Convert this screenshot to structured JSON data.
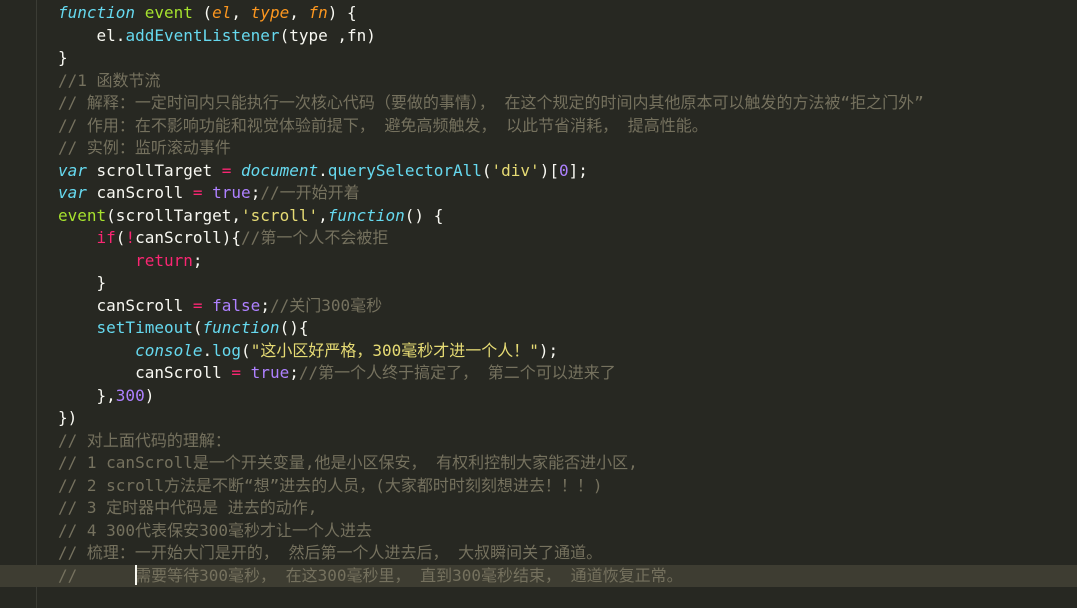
{
  "editor": {
    "lines": [
      {
        "segments": [
          {
            "t": "function",
            "c": "kw-it"
          },
          {
            "t": " ",
            "c": "plain"
          },
          {
            "t": "event",
            "c": "fn-name"
          },
          {
            "t": " (",
            "c": "plain"
          },
          {
            "t": "el",
            "c": "param"
          },
          {
            "t": ", ",
            "c": "plain"
          },
          {
            "t": "type",
            "c": "param"
          },
          {
            "t": ", ",
            "c": "plain"
          },
          {
            "t": "fn",
            "c": "param"
          },
          {
            "t": ") {",
            "c": "plain"
          }
        ]
      },
      {
        "segments": [
          {
            "t": "    el.",
            "c": "plain"
          },
          {
            "t": "addEventListener",
            "c": "method"
          },
          {
            "t": "(type ,fn)",
            "c": "plain"
          }
        ]
      },
      {
        "segments": [
          {
            "t": "}",
            "c": "plain"
          }
        ]
      },
      {
        "segments": [
          {
            "t": "//1 函数节流",
            "c": "com"
          }
        ]
      },
      {
        "segments": [
          {
            "t": "// 解释：一定时间内只能执行一次核心代码（要做的事情）， 在这个规定的时间内其他原本可以触发的方法被“拒之门外”",
            "c": "com"
          }
        ]
      },
      {
        "segments": [
          {
            "t": "// 作用：在不影响功能和视觉体验前提下， 避免高频触发， 以此节省消耗， 提高性能。",
            "c": "com"
          }
        ]
      },
      {
        "segments": [
          {
            "t": "// 实例：监听滚动事件",
            "c": "com"
          }
        ]
      },
      {
        "segments": [
          {
            "t": "var",
            "c": "kw-it"
          },
          {
            "t": " scrollTarget ",
            "c": "plain"
          },
          {
            "t": "=",
            "c": "op"
          },
          {
            "t": " ",
            "c": "plain"
          },
          {
            "t": "document",
            "c": "kw-it"
          },
          {
            "t": ".",
            "c": "plain"
          },
          {
            "t": "querySelectorAll",
            "c": "method"
          },
          {
            "t": "(",
            "c": "plain"
          },
          {
            "t": "'div'",
            "c": "str"
          },
          {
            "t": ")[",
            "c": "plain"
          },
          {
            "t": "0",
            "c": "num"
          },
          {
            "t": "];",
            "c": "plain"
          }
        ]
      },
      {
        "segments": [
          {
            "t": "var",
            "c": "kw-it"
          },
          {
            "t": " canScroll ",
            "c": "plain"
          },
          {
            "t": "=",
            "c": "op"
          },
          {
            "t": " ",
            "c": "plain"
          },
          {
            "t": "true",
            "c": "num"
          },
          {
            "t": ";",
            "c": "plain"
          },
          {
            "t": "//一开始开着",
            "c": "com"
          }
        ]
      },
      {
        "segments": [
          {
            "t": "event",
            "c": "fn-name"
          },
          {
            "t": "(scrollTarget,",
            "c": "plain"
          },
          {
            "t": "'scroll'",
            "c": "str"
          },
          {
            "t": ",",
            "c": "plain"
          },
          {
            "t": "function",
            "c": "kw-it"
          },
          {
            "t": "() {",
            "c": "plain"
          }
        ]
      },
      {
        "segments": [
          {
            "t": "    ",
            "c": "plain"
          },
          {
            "t": "if",
            "c": "op"
          },
          {
            "t": "(",
            "c": "plain"
          },
          {
            "t": "!",
            "c": "op"
          },
          {
            "t": "canScroll){",
            "c": "plain"
          },
          {
            "t": "//第一个人不会被拒",
            "c": "com"
          }
        ]
      },
      {
        "segments": [
          {
            "t": "        ",
            "c": "plain"
          },
          {
            "t": "return",
            "c": "op"
          },
          {
            "t": ";",
            "c": "plain"
          }
        ]
      },
      {
        "segments": [
          {
            "t": "    }",
            "c": "plain"
          }
        ]
      },
      {
        "segments": [
          {
            "t": "    canScroll ",
            "c": "plain"
          },
          {
            "t": "=",
            "c": "op"
          },
          {
            "t": " ",
            "c": "plain"
          },
          {
            "t": "false",
            "c": "num"
          },
          {
            "t": ";",
            "c": "plain"
          },
          {
            "t": "//关门300毫秒",
            "c": "com"
          }
        ]
      },
      {
        "segments": [
          {
            "t": "    ",
            "c": "plain"
          },
          {
            "t": "setTimeout",
            "c": "method"
          },
          {
            "t": "(",
            "c": "plain"
          },
          {
            "t": "function",
            "c": "kw-it"
          },
          {
            "t": "(){",
            "c": "plain"
          }
        ]
      },
      {
        "segments": [
          {
            "t": "        ",
            "c": "plain"
          },
          {
            "t": "console",
            "c": "kw-it"
          },
          {
            "t": ".",
            "c": "plain"
          },
          {
            "t": "log",
            "c": "method"
          },
          {
            "t": "(",
            "c": "plain"
          },
          {
            "t": "\"这小区好严格，300毫秒才进一个人！\"",
            "c": "str"
          },
          {
            "t": ");",
            "c": "plain"
          }
        ]
      },
      {
        "segments": [
          {
            "t": "        canScroll ",
            "c": "plain"
          },
          {
            "t": "=",
            "c": "op"
          },
          {
            "t": " ",
            "c": "plain"
          },
          {
            "t": "true",
            "c": "num"
          },
          {
            "t": ";",
            "c": "plain"
          },
          {
            "t": "//第一个人终于搞定了， 第二个可以进来了",
            "c": "com"
          }
        ]
      },
      {
        "segments": [
          {
            "t": "    },",
            "c": "plain"
          },
          {
            "t": "300",
            "c": "num"
          },
          {
            "t": ")",
            "c": "plain"
          }
        ]
      },
      {
        "segments": [
          {
            "t": "})",
            "c": "plain"
          }
        ]
      },
      {
        "segments": [
          {
            "t": "// 对上面代码的理解：",
            "c": "com"
          }
        ]
      },
      {
        "segments": [
          {
            "t": "// 1 canScroll是一个开关变量,他是小区保安， 有权利控制大家能否进小区,",
            "c": "com"
          }
        ]
      },
      {
        "segments": [
          {
            "t": "// 2 scroll方法是不断“想”进去的人员，(大家都时时刻刻想进去！！！)",
            "c": "com"
          }
        ]
      },
      {
        "segments": [
          {
            "t": "// 3 定时器中代码是 进去的动作,",
            "c": "com"
          }
        ]
      },
      {
        "segments": [
          {
            "t": "// 4 300代表保安300毫秒才让一个人进去",
            "c": "com"
          }
        ]
      },
      {
        "segments": [
          {
            "t": "// 梳理：一开始大门是开的， 然后第一个人进去后， 大叔瞬间关了通道。",
            "c": "com"
          }
        ]
      },
      {
        "segments": [
          {
            "t": "//      ",
            "c": "com"
          },
          {
            "t": "",
            "c": "cursor"
          },
          {
            "t": "需要等待300毫秒， 在这300毫秒里， 直到300毫秒结束， 通道恢复正常。",
            "c": "com"
          }
        ],
        "active": true
      }
    ]
  }
}
